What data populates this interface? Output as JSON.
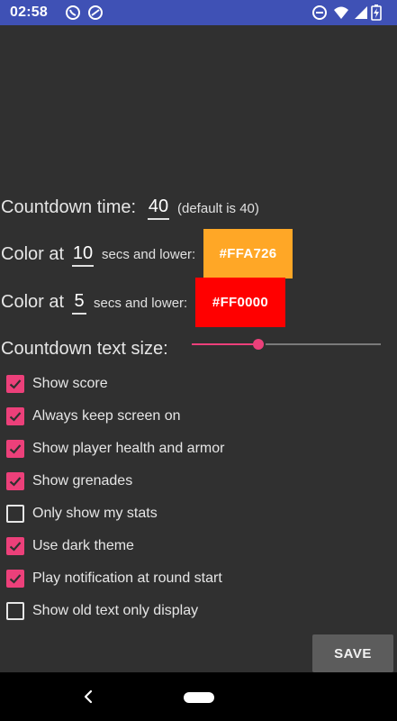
{
  "status_bar": {
    "time": "02:58",
    "icons": [
      "whatsapp-icon",
      "sync-icon",
      "do-not-disturb-icon",
      "wifi-icon",
      "signal-icon",
      "battery-charging-icon"
    ]
  },
  "settings": {
    "countdown_time": {
      "label": "Countdown time:",
      "value": "40",
      "hint": "(default is 40)"
    },
    "color_threshold_1": {
      "prefix": "Color at",
      "value": "10",
      "suffix": "secs and lower:",
      "color_label": "#FFA726",
      "color": "#FFA726"
    },
    "color_threshold_2": {
      "prefix": "Color at",
      "value": "5",
      "suffix": "secs and lower:",
      "color_label": "#FF0000",
      "color": "#FF0000"
    },
    "text_size": {
      "label": "Countdown text size:",
      "fraction": 0.35
    },
    "checkboxes": [
      {
        "label": "Show score",
        "checked": true
      },
      {
        "label": "Always keep screen on",
        "checked": true
      },
      {
        "label": "Show player health and armor",
        "checked": true
      },
      {
        "label": "Show grenades",
        "checked": true
      },
      {
        "label": "Only show my stats",
        "checked": false
      },
      {
        "label": "Use dark theme",
        "checked": true
      },
      {
        "label": "Play notification at round start",
        "checked": true
      },
      {
        "label": "Show old text only display",
        "checked": false
      }
    ],
    "save_label": "SAVE"
  },
  "colors": {
    "accent": "#EC407A",
    "status_bar": "#3F51B5",
    "background": "#303030"
  }
}
